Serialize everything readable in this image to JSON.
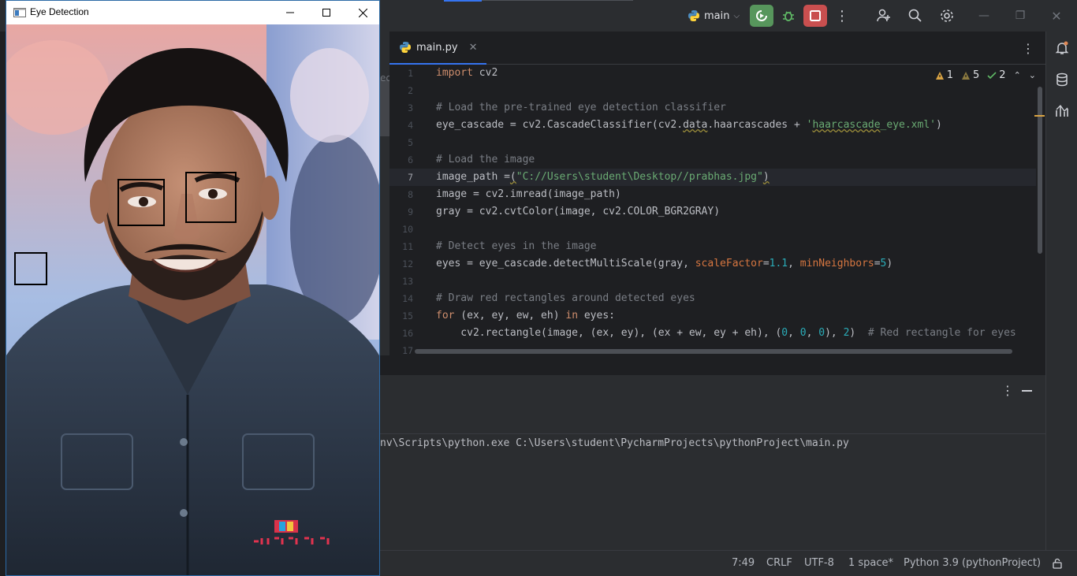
{
  "eye_window": {
    "title": "Eye Detection",
    "photo_watermark_text": "INDUSTRY HIT"
  },
  "toolbar": {
    "branch": "main"
  },
  "project_fragment": "ec",
  "editor": {
    "tab_label": "main.py",
    "inspections": {
      "errors": "1",
      "warnings": "5",
      "weak_warnings": "2"
    },
    "current_line": 7,
    "line_numbers": [
      "1",
      "2",
      "3",
      "4",
      "5",
      "6",
      "7",
      "8",
      "9",
      "10",
      "11",
      "12",
      "13",
      "14",
      "15",
      "16",
      "17"
    ]
  },
  "run_console": {
    "command_line": "nv\\Scripts\\python.exe C:\\Users\\student\\PycharmProjects\\pythonProject\\main.py"
  },
  "statusbar": {
    "position": "7:49",
    "line_separator": "CRLF",
    "encoding": "UTF-8",
    "indent": "1 space*",
    "interpreter": "Python 3.9 (pythonProject)"
  },
  "colors": {
    "run_button": "#57965c",
    "stop_button": "#c94f4f",
    "accent": "#3574f0"
  }
}
